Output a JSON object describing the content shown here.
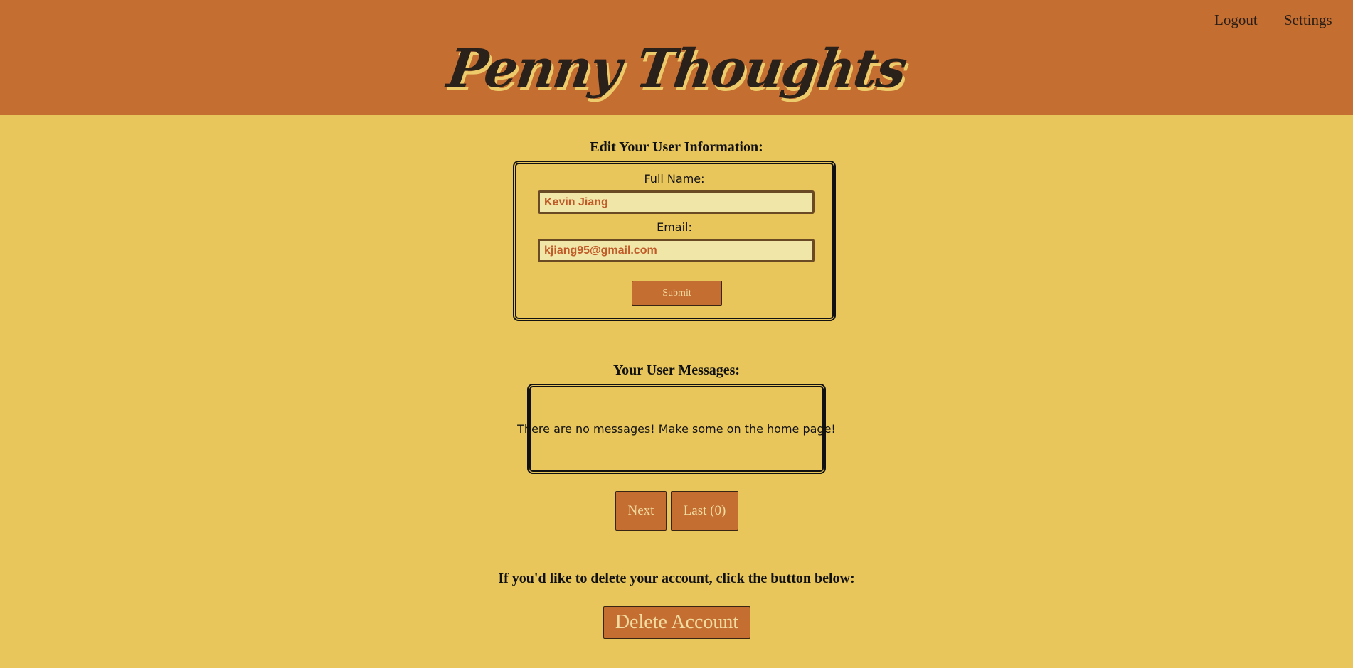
{
  "nav": {
    "logout": "Logout",
    "settings": "Settings"
  },
  "site": {
    "title": "Penny Thoughts"
  },
  "edit_form": {
    "heading": "Edit Your User Information:",
    "name_label": "Full Name:",
    "name_value": "Kevin Jiang",
    "email_label": "Email:",
    "email_value": "kjiang95@gmail.com",
    "submit_label": "Submit"
  },
  "messages": {
    "heading": "Your User Messages:",
    "empty_text": "There are no messages! Make some on the home page!",
    "next_label": "Next",
    "last_label": "Last (0)"
  },
  "delete": {
    "prompt": "If you'd like to delete your account, click the button below:",
    "button_label": "Delete Account"
  },
  "colors": {
    "header_bg": "#c46e32",
    "page_bg": "#e8c65c",
    "input_bg": "#efe6a8",
    "input_text": "#c05a28"
  }
}
